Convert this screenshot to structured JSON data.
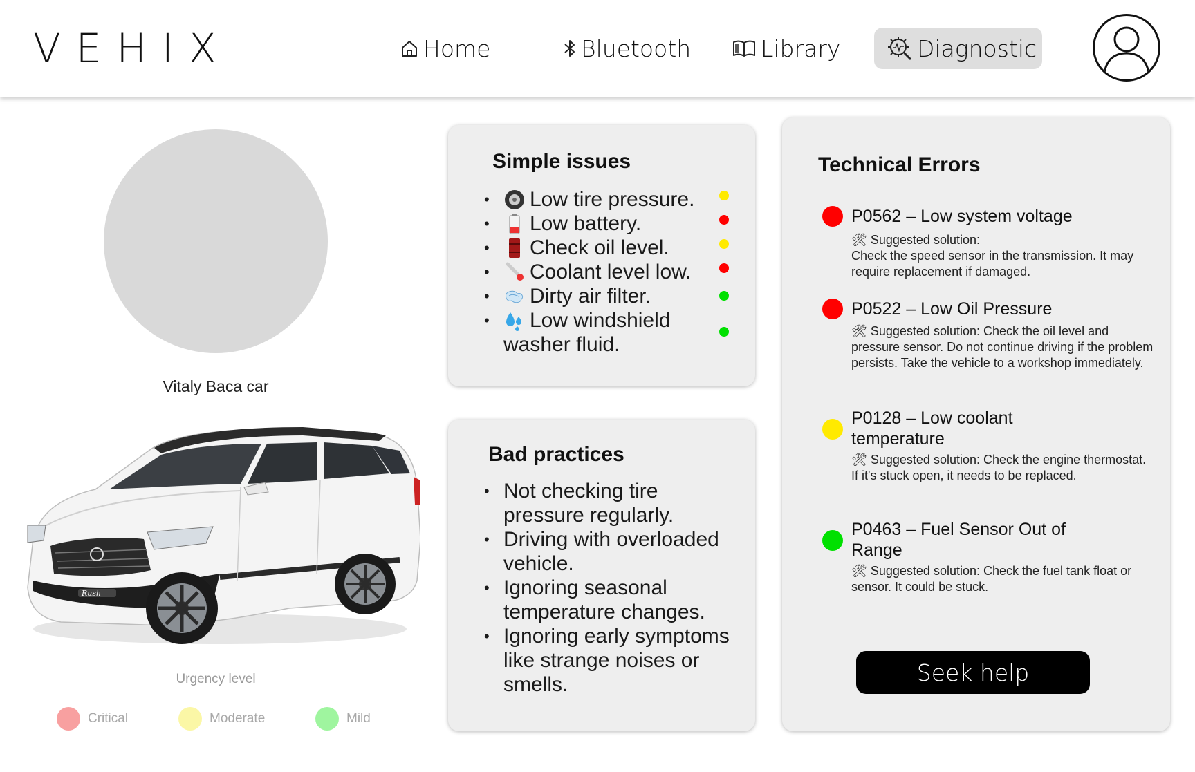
{
  "app": {
    "logo": "VEHIX"
  },
  "nav": {
    "home": "Home",
    "bluetooth": "Bluetooth",
    "library": "Library",
    "diagnostic": "Diagnostic",
    "active": "diagnostic"
  },
  "vehicle": {
    "name": "Vitaly Baca car"
  },
  "urgency": {
    "title": "Urgency level",
    "levels": [
      {
        "label": "Critical",
        "color": "#f8a0a0"
      },
      {
        "label": "Moderate",
        "color": "#fbf7a6"
      },
      {
        "label": "Mild",
        "color": "#9ff59f"
      }
    ]
  },
  "simple_issues": {
    "title": "Simple issues",
    "items": [
      {
        "icon": "tire-icon",
        "text": "Low tire pressure.",
        "status_color": "#ffea00"
      },
      {
        "icon": "battery-icon",
        "text": "Low battery.",
        "status_color": "#ff0000"
      },
      {
        "icon": "oil-drum-icon",
        "text": "Check oil level.",
        "status_color": "#ffea00"
      },
      {
        "icon": "thermometer-icon",
        "text": "Coolant level low.",
        "status_color": "#ff0000"
      },
      {
        "icon": "air-filter-icon",
        "text": "Dirty air filter.",
        "status_color": "#00e000"
      },
      {
        "icon": "washer-fluid-icon",
        "text": "Low windshield",
        "text2": "washer fluid.",
        "status_color": "#00e000"
      }
    ]
  },
  "bad_practices": {
    "title": "Bad practices",
    "items": [
      {
        "line1": "Not checking tire",
        "line2": "pressure regularly."
      },
      {
        "line1": "Driving with overloaded",
        "line2": "vehicle."
      },
      {
        "line1": "Ignoring seasonal",
        "line2": "temperature changes."
      },
      {
        "line1": "Ignoring early symptoms",
        "line2": "like strange noises or",
        "line3": "smells."
      }
    ]
  },
  "technical_errors": {
    "title": "Technical Errors",
    "items": [
      {
        "code_title": "P0562 – Low system voltage",
        "title2": "",
        "solution": "Suggested solution:",
        "solution_detail": "Check the speed sensor in the transmission. It may require replacement if damaged.",
        "color": "#ff0000"
      },
      {
        "code_title": "P0522 – Low Oil Pressure",
        "title2": "",
        "solution": "Suggested solution: Check the oil level and pressure sensor. Do not continue driving if the problem persists. Take the vehicle to a workshop immediately.",
        "solution_detail": "",
        "color": "#ff0000"
      },
      {
        "code_title": "P0128 – Low coolant",
        "title2": "temperature",
        "solution": "Suggested solution: Check the engine thermostat. If it's stuck open, it needs to be replaced.",
        "solution_detail": "",
        "color": "#ffea00"
      },
      {
        "code_title": "P0463 – Fuel Sensor Out of",
        "title2": "Range",
        "solution": "Suggested solution: Check the fuel tank float or sensor. It could be stuck.",
        "solution_detail": "",
        "color": "#00e000"
      }
    ],
    "button": "Seek help"
  }
}
